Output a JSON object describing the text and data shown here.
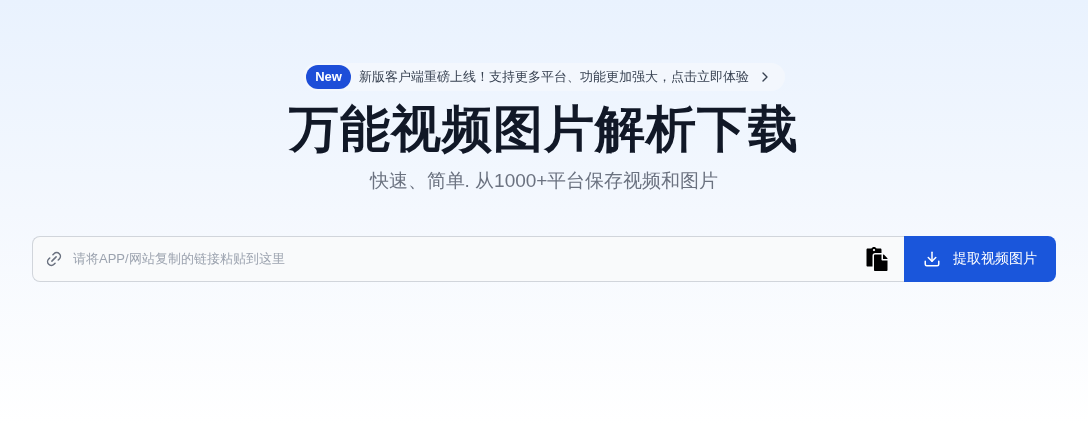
{
  "announcement": {
    "badge": "New",
    "text": "新版客户端重磅上线！支持更多平台、功能更加强大，点击立即体验"
  },
  "title": "万能视频图片解析下载",
  "subtitle": "快速、简单. 从1000+平台保存视频和图片",
  "url_input": {
    "placeholder": "请将APP/网站复制的链接粘贴到这里"
  },
  "submit_button": {
    "label": "提取视频图片"
  }
}
